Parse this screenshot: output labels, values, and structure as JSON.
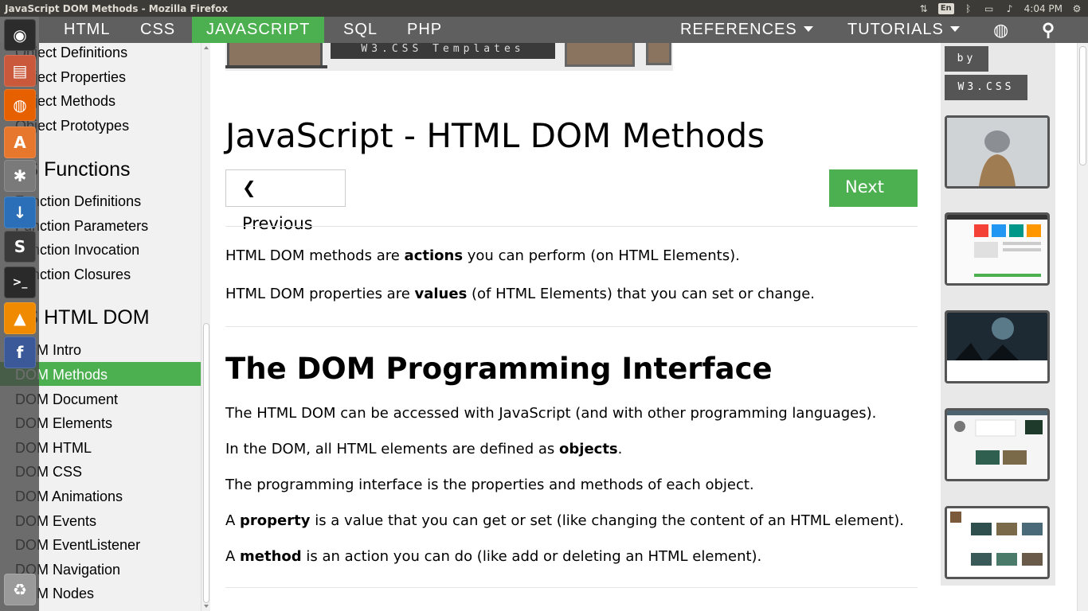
{
  "window": {
    "title": "JavaScript DOM Methods - Mozilla Firefox"
  },
  "tray": {
    "lang": "En",
    "clock": "4:04 PM"
  },
  "launcher": {
    "items": [
      {
        "name": "ubuntu-dash-icon",
        "glyph": "◉",
        "color": "#2c2c2c"
      },
      {
        "name": "files-icon",
        "glyph": "▤",
        "color": "#c9593a"
      },
      {
        "name": "firefox-icon",
        "glyph": "◍",
        "color": "#e66000"
      },
      {
        "name": "software-center-icon",
        "glyph": "A",
        "color": "#e8772e"
      },
      {
        "name": "system-settings-icon",
        "glyph": "✱",
        "color": "#7a7a7a"
      },
      {
        "name": "downloads-icon",
        "glyph": "↓",
        "color": "#2a6fb8"
      },
      {
        "name": "sublime-text-icon",
        "glyph": "S",
        "color": "#3a3a3a"
      },
      {
        "name": "terminal-icon",
        "glyph": ">_",
        "color": "#2a2a2a"
      },
      {
        "name": "vlc-icon",
        "glyph": "▲",
        "color": "#f08a00"
      },
      {
        "name": "facebook-icon",
        "glyph": "f",
        "color": "#3b5998"
      },
      {
        "name": "trash-icon",
        "glyph": "♻",
        "color": "#9a9a9a"
      }
    ]
  },
  "nav": {
    "items": [
      "HTML",
      "CSS",
      "JAVASCRIPT",
      "SQL",
      "PHP"
    ],
    "active": "JAVASCRIPT",
    "references": "REFERENCES",
    "tutorials": "TUTORIALS"
  },
  "sidebar": {
    "links_top": [
      "Object Definitions",
      "Object Properties",
      "Object Methods",
      "Object Prototypes"
    ],
    "head_functions": "JS Functions",
    "links_functions": [
      "Function Definitions",
      "Function Parameters",
      "Function Invocation",
      "Function Closures"
    ],
    "head_dom": "JS HTML DOM",
    "links_dom": [
      "DOM Intro",
      "DOM Methods",
      "DOM Document",
      "DOM Elements",
      "DOM HTML",
      "DOM CSS",
      "DOM Animations",
      "DOM Events",
      "DOM EventListener",
      "DOM Navigation",
      "DOM Nodes"
    ],
    "selected": "DOM Methods"
  },
  "main": {
    "banner_text": "W3.CSS Templates",
    "title": "JavaScript - HTML DOM Methods",
    "prev": "❮ Previous",
    "next": "Next ❯",
    "intro": [
      {
        "pre": "HTML DOM methods are ",
        "b": "actions",
        "post": " you can perform (on HTML Elements)."
      },
      {
        "pre": "HTML DOM properties are ",
        "b": "values",
        "post": " (of HTML Elements) that you can set or change."
      }
    ],
    "section_title": "The DOM Programming Interface",
    "section_paras": [
      {
        "pre": "The HTML DOM can be accessed with JavaScript (and with other programming languages).",
        "b": "",
        "post": ""
      },
      {
        "pre": "In the DOM, all HTML elements are defined as ",
        "b": "objects",
        "post": "."
      },
      {
        "pre": "The programming interface is the properties and methods of each object.",
        "b": "",
        "post": ""
      },
      {
        "pre": "A ",
        "b": "property",
        "post": " is a value that you can get or set (like changing the content of an HTML element)."
      },
      {
        "pre": "A ",
        "b": "method",
        "post": " is an action you can do (like add or deleting an HTML element)."
      }
    ]
  },
  "ads": {
    "by": "by",
    "brand": "W3.CSS"
  },
  "colors": {
    "accent": "#4caf50",
    "navbar": "#5f5f5f",
    "panel": "#3c3b37",
    "sidebar": "#f1f1f1"
  }
}
